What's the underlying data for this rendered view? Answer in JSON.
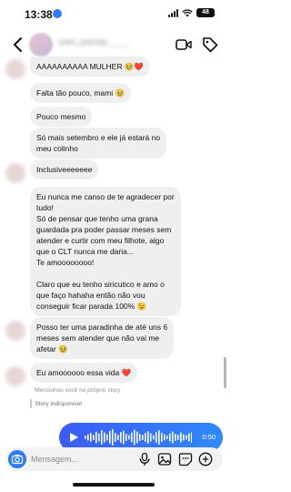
{
  "status_bar": {
    "time": "13:38",
    "battery": "48"
  },
  "header": {
    "contact_name": "suko_pancaa_____"
  },
  "messages": [
    {
      "text": "AAAAAAAAAA MULHER 🥹❤️"
    },
    {
      "text": "Falta tão pouco, mami 🥹"
    },
    {
      "text": "Pouco mesmo"
    },
    {
      "text": "Só mais setembro e ele já estará no\nmeu colinho"
    },
    {
      "text": "Inclusiveeeeeee"
    },
    {
      "text": "Eu nunca me canso de te agradecer por\ntudo!\nSó de pensar que tenho uma grana\nguardada pra poder passar meses sem\natender e curtir com meu filhote, algo\nque o CLT nunca me daria...\nTe amoooooooo!\n\nClaro que eu tenho siricutico e amo o\nque faço hahaha então não vou\nconseguir ficar parada 100% 😉"
    },
    {
      "text": "Posso ter uma paradinha de até uns 6\nmeses sem atender que não vai me\nafetar 🥹"
    },
    {
      "text": "Eu amoooooo essa vida ❤️"
    }
  ],
  "notes": {
    "mentioned": "Mencionou você no próprio story",
    "story_unavailable": "Story indisponível"
  },
  "voice_message": {
    "duration": "0:50"
  },
  "composer": {
    "placeholder": "Mensagem..."
  },
  "colors": {
    "accent": "#2f7cf6",
    "bubble": "#efefef",
    "voice_start": "#3b5bf5",
    "voice_end": "#2f8af8"
  }
}
